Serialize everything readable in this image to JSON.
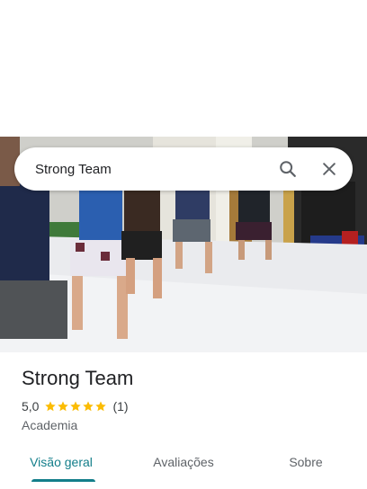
{
  "search": {
    "query": "Strong Team",
    "search_icon": "search-icon",
    "close_icon": "close-icon"
  },
  "place": {
    "name": "Strong Team",
    "rating": "5,0",
    "stars": 5,
    "review_count": "(1)",
    "category": "Academia"
  },
  "tabs": [
    {
      "label": "Visão geral",
      "active": true
    },
    {
      "label": "Avaliações",
      "active": false
    },
    {
      "label": "Sobre",
      "active": false
    }
  ],
  "colors": {
    "accent": "#137e8a",
    "star": "#fbbc04"
  }
}
